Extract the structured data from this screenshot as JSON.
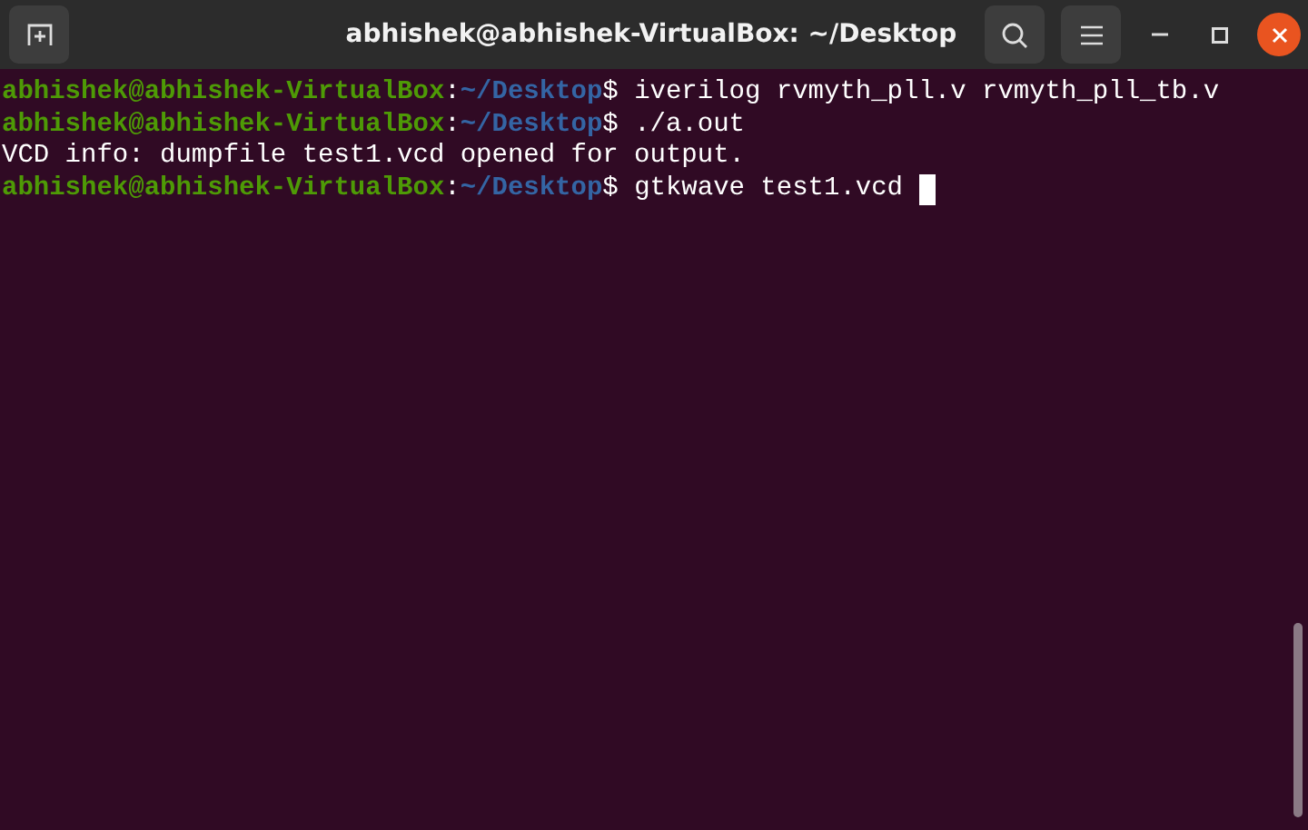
{
  "window": {
    "title": "abhishek@abhishek-VirtualBox: ~/Desktop"
  },
  "terminal": {
    "lines": [
      {
        "kind": "prompt",
        "user_host": "abhishek@abhishek-VirtualBox",
        "separator": ":",
        "path": "~/Desktop",
        "command": "$ iverilog rvmyth_pll.v rvmyth_pll_tb.v"
      },
      {
        "kind": "prompt",
        "user_host": "abhishek@abhishek-VirtualBox",
        "separator": ":",
        "path": "~/Desktop",
        "command": "$ ./a.out"
      },
      {
        "kind": "output",
        "text": "VCD info: dumpfile test1.vcd opened for output."
      },
      {
        "kind": "prompt",
        "user_host": "abhishek@abhishek-VirtualBox",
        "separator": ":",
        "path": "~/Desktop",
        "command": "$ gtkwave test1.vcd ",
        "cursor": true
      }
    ]
  }
}
